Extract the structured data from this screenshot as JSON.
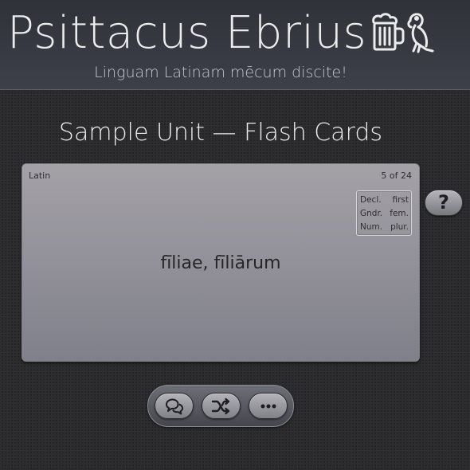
{
  "header": {
    "app_title": "Psittacus Ebrius",
    "logo_icon": "beer-mug-and-parrot-icon",
    "subtitle": "Linguam Latinam mēcum discite!"
  },
  "main": {
    "page_title": "Sample Unit — Flash Cards"
  },
  "card": {
    "language": "Latin",
    "counter": "5 of 24",
    "grammar": [
      {
        "label": "Decl.",
        "value": "first"
      },
      {
        "label": "Gndr.",
        "value": "fem."
      },
      {
        "label": "Num.",
        "value": "plur."
      }
    ],
    "text": "fīliae, fīliārum"
  },
  "help_button": {
    "label": "?"
  },
  "toolbar": {
    "buttons": [
      {
        "icon": "speech-bubbles-icon"
      },
      {
        "icon": "shuffle-icon"
      },
      {
        "icon": "more-options-icon"
      }
    ]
  },
  "colors": {
    "header_bg": "#3d4049",
    "page_bg": "#2b2b2d",
    "card_top": "#a4a1a7",
    "card_bottom": "#80808a",
    "text_light": "#ececec"
  }
}
